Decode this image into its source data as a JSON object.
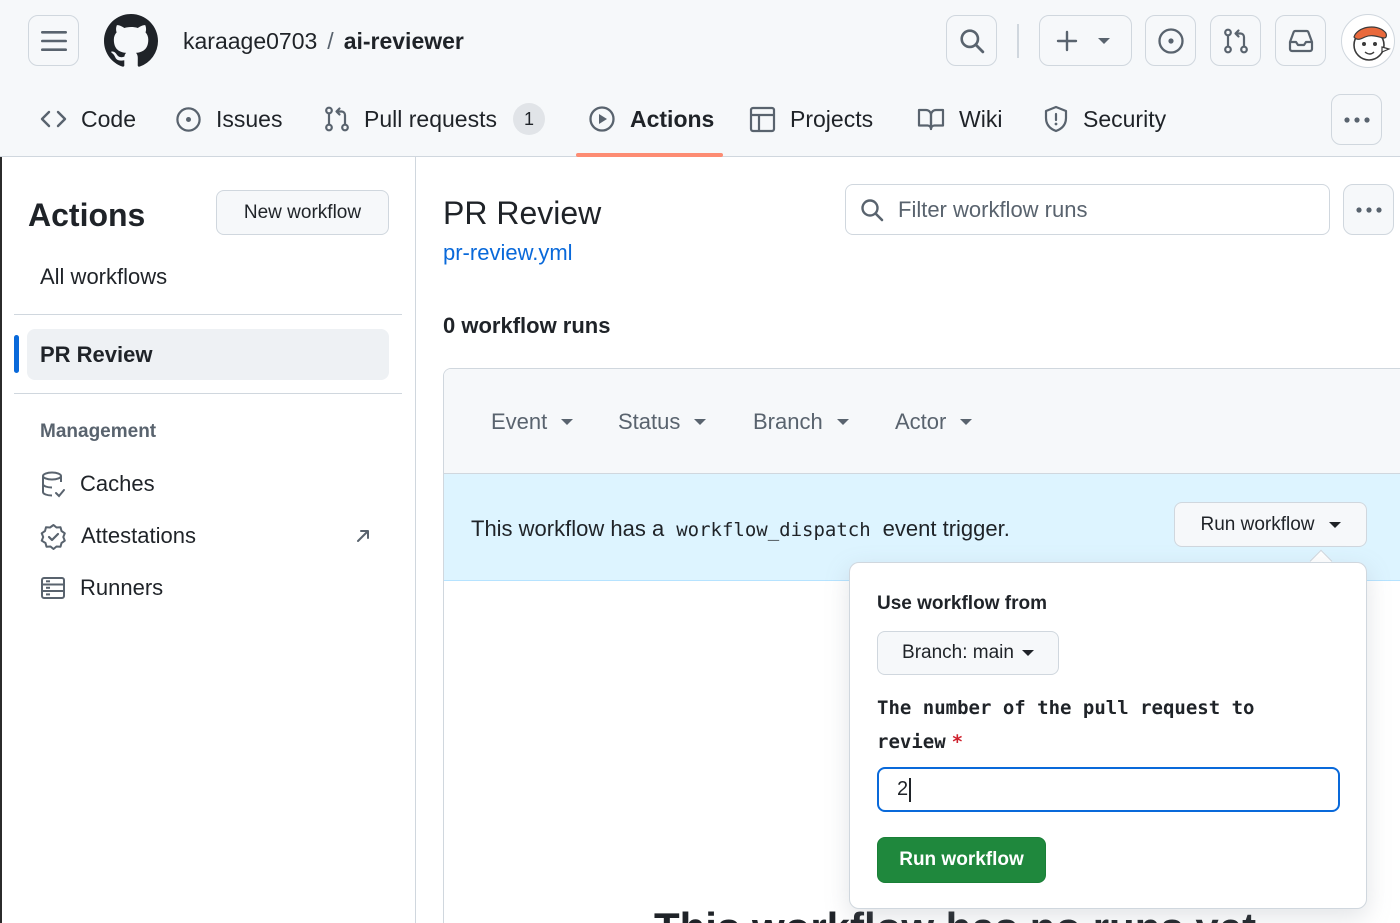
{
  "header": {
    "owner": "karaage0703",
    "separator": "/",
    "repo": "ai-reviewer"
  },
  "tabs": [
    {
      "label": "Code",
      "icon": "code-icon"
    },
    {
      "label": "Issues",
      "icon": "issue-opened-icon"
    },
    {
      "label": "Pull requests",
      "icon": "git-pull-request-icon",
      "count": "1"
    },
    {
      "label": "Actions",
      "icon": "play-icon",
      "selected": true
    },
    {
      "label": "Projects",
      "icon": "table-icon"
    },
    {
      "label": "Wiki",
      "icon": "book-icon"
    },
    {
      "label": "Security",
      "icon": "shield-icon"
    }
  ],
  "sidebar": {
    "title": "Actions",
    "new_workflow_label": "New workflow",
    "all_workflows": "All workflows",
    "selected_workflow": "PR Review",
    "management_heading": "Management",
    "management_items": [
      {
        "label": "Caches",
        "icon": "database-icon"
      },
      {
        "label": "Attestations",
        "icon": "verified-icon",
        "external": true
      },
      {
        "label": "Runners",
        "icon": "server-icon"
      }
    ]
  },
  "main": {
    "workflow_title": "PR Review",
    "workflow_file": "pr-review.yml",
    "filter_placeholder": "Filter workflow runs",
    "runs_count": "0 workflow runs",
    "filters": [
      "Event",
      "Status",
      "Branch",
      "Actor"
    ],
    "dispatch": {
      "prefix": "This workflow has a",
      "code": "workflow_dispatch",
      "suffix": "event trigger.",
      "button_label": "Run workflow"
    },
    "truncated_heading": "This workflow has no runs yet."
  },
  "popover": {
    "label": "Use workflow from",
    "branch_button": "Branch: main",
    "input_description": "The number of the pull request to review",
    "required_mark": "*",
    "input_value": "2",
    "submit_label": "Run workflow"
  },
  "colors": {
    "accent": "#0969da",
    "tab_underline": "#fd8c73",
    "primary_button": "#1f883d",
    "dispatch_banner": "#ddf4ff",
    "required": "#cf222e"
  }
}
